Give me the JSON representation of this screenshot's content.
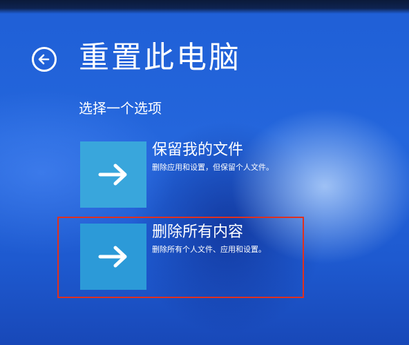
{
  "screen": {
    "title": "重置此电脑",
    "subtitle": "选择一个选项",
    "back_icon": "back-arrow-circle-icon"
  },
  "options": [
    {
      "title": "保留我的文件",
      "description": "删除应用和设置，但保留个人文件。",
      "icon": "arrow-right-icon"
    },
    {
      "title": "删除所有内容",
      "description": "删除所有个人文件、应用和设置。",
      "icon": "arrow-right-icon",
      "highlighted": true
    }
  ],
  "colors": {
    "background": "#2466dc",
    "tile": "#39a6dc",
    "text": "#ffffff",
    "highlight": "#e0301e"
  }
}
